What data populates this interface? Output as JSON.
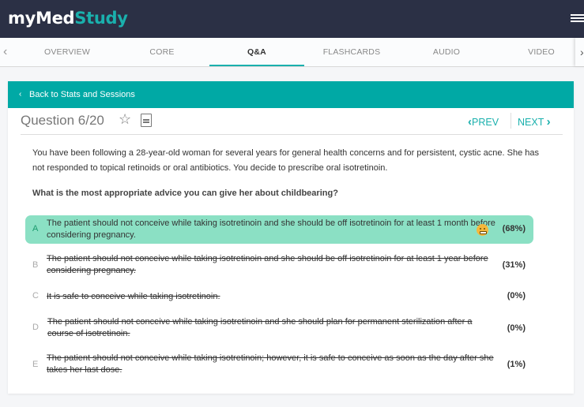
{
  "app": {
    "logo_part1": "myMed",
    "logo_part2": "Study",
    "brand_color": "#1ab0ad"
  },
  "tabs": [
    {
      "label": "OVERVIEW",
      "active": false
    },
    {
      "label": "CORE",
      "active": false
    },
    {
      "label": "Q&A",
      "active": true
    },
    {
      "label": "FLASHCARDS",
      "active": false
    },
    {
      "label": "AUDIO",
      "active": false
    },
    {
      "label": "VIDEO",
      "active": false
    }
  ],
  "icons": {
    "tab_left": "‹",
    "tab_right": "›",
    "back_chevron": "‹",
    "star": "☆",
    "prev_chevron": "‹",
    "next_chevron": "›"
  },
  "back_link": "Back to Stats and Sessions",
  "question": {
    "title": "Question 6/20",
    "prev_label": "PREV",
    "next_label": "NEXT",
    "stem": "You have been following a 28-year-old woman for several years for general health concerns and for persistent, cystic acne. She has not responded to topical retinoids or oral antibiotics. You decide to prescribe oral isotretinoin.",
    "prompt": "What is the most appropriate advice you can give her about childbearing?",
    "options": [
      {
        "letter": "A",
        "text": "The patient should not conceive while taking isotretinoin and she should be off isotretinoin for at least 1 month before considering pregnancy.",
        "percent": "(68%)",
        "state": "correct"
      },
      {
        "letter": "B",
        "text": "The patient should not conceive while taking isotretinoin and she should be off isotretinoin for at least 1 year before considering pregnancy.",
        "percent": "(31%)",
        "state": "wrong"
      },
      {
        "letter": "C",
        "text": "It is safe to conceive while taking isotretinoin.",
        "percent": "(0%)",
        "state": "wrong"
      },
      {
        "letter": "D",
        "text": "The patient should not conceive while taking isotretinoin and she should plan for permanent sterilization after a course of isotretinoin.",
        "percent": "(0%)",
        "state": "wrong"
      },
      {
        "letter": "E",
        "text": "The patient should not conceive while taking isotretinoin; however, it is safe to conceive as soon as the day after she takes her last dose.",
        "percent": "(1%)",
        "state": "wrong"
      }
    ]
  }
}
